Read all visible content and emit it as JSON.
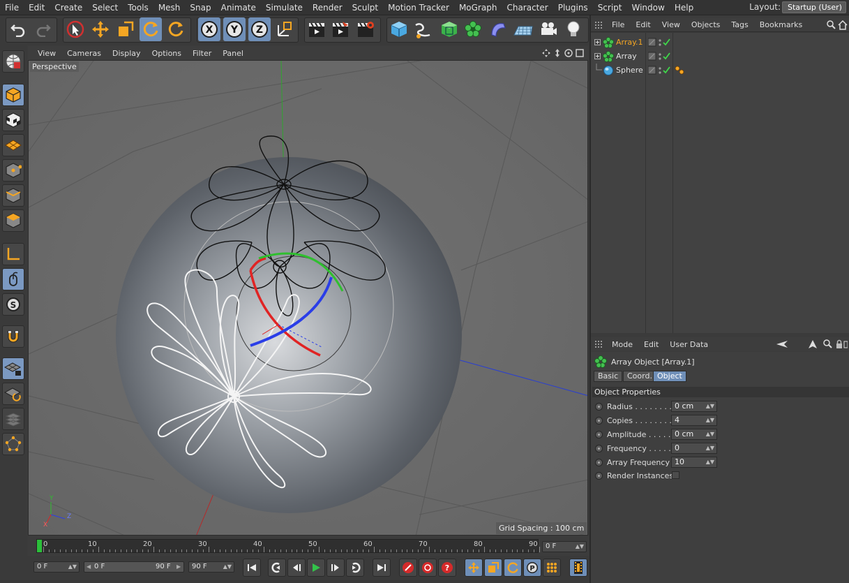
{
  "menu": [
    "File",
    "Edit",
    "Create",
    "Select",
    "Tools",
    "Mesh",
    "Snap",
    "Animate",
    "Simulate",
    "Render",
    "Sculpt",
    "Motion Tracker",
    "MoGraph",
    "Character",
    "Plugins",
    "Script",
    "Window",
    "Help"
  ],
  "layout": {
    "label": "Layout:",
    "value": "Startup (User)"
  },
  "viewport": {
    "menu": [
      "View",
      "Cameras",
      "Display",
      "Options",
      "Filter",
      "Panel"
    ],
    "camera_label": "Perspective",
    "grid_spacing": "Grid Spacing : 100 cm",
    "axis_labels": {
      "x": "X",
      "y": "Y",
      "z": "Z"
    }
  },
  "timeline": {
    "ticks": [
      "0",
      "10",
      "20",
      "30",
      "40",
      "50",
      "60",
      "70",
      "80",
      "90"
    ],
    "current_frame_field": "0 F",
    "start_field": "0 F",
    "range_start": "0 F",
    "range_end": "90 F",
    "end_field": "90 F"
  },
  "object_manager": {
    "menu": [
      "File",
      "Edit",
      "View",
      "Objects",
      "Tags",
      "Bookmarks"
    ],
    "objects": [
      {
        "name": "Array.1",
        "selected": true
      },
      {
        "name": "Array",
        "selected": false
      },
      {
        "name": "Sphere",
        "selected": false
      }
    ]
  },
  "attributes": {
    "menu": [
      "Mode",
      "Edit",
      "User Data"
    ],
    "object_title": "Array Object [Array.1]",
    "tabs": [
      {
        "label": "Basic",
        "active": false
      },
      {
        "label": "Coord.",
        "active": false
      },
      {
        "label": "Object",
        "active": true
      }
    ],
    "section": "Object Properties",
    "properties": [
      {
        "label": "Radius . . . . . . . .",
        "value": "0 cm"
      },
      {
        "label": "Copies . . . . . . . .",
        "value": "4"
      },
      {
        "label": "Amplitude . . . . .",
        "value": "0 cm"
      },
      {
        "label": "Frequency . . . . .",
        "value": "0"
      },
      {
        "label": "Array Frequency",
        "value": "10"
      }
    ],
    "render_instances_label": "Render Instances"
  },
  "colors": {
    "accent": "#6f8fb8",
    "selected_object": "#f5a623",
    "axis_x": "#d03030",
    "axis_y": "#30c030",
    "axis_z": "#2040e0"
  }
}
